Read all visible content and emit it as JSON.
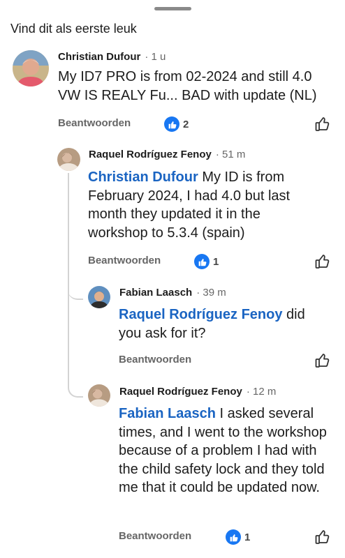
{
  "header": {
    "title": "Vind dit als eerste leuk"
  },
  "comments": [
    {
      "author": "Christian Dufour",
      "time": "· 1 u",
      "mention": "",
      "text": "My ID7 PRO is from 02-2024 and still 4.0 VW IS REALY Fu... BAD with update (NL)",
      "reply_label": "Beantwoorden",
      "reaction_count": "2",
      "avatar_icon": "avatar-christian"
    },
    {
      "author": "Raquel Rodríguez Fenoy",
      "time": "· 51 m",
      "mention": "Christian Dufour",
      "text": " My ID is from February 2024, I had 4.0 but last month they updated it in the workshop to 5.3.4 (spain)",
      "reply_label": "Beantwoorden",
      "reaction_count": "1",
      "avatar_icon": "avatar-raquel"
    },
    {
      "author": "Fabian Laasch",
      "time": "· 39 m",
      "mention": "Raquel Rodríguez Fenoy",
      "text": " did you ask for it?",
      "reply_label": "Beantwoorden",
      "reaction_count": "",
      "avatar_icon": "avatar-fabian"
    },
    {
      "author": "Raquel Rodríguez Fenoy",
      "time": "· 12 m",
      "mention": "Fabian Laasch",
      "text": " I asked several times, and I went to the workshop because of a problem I had with the child safety lock and they told  me that it could be updated now.",
      "reply_label": "Beantwoorden",
      "reaction_count": "1",
      "avatar_icon": "avatar-raquel"
    }
  ],
  "colors": {
    "mention": "#1a64c2",
    "like_badge": "#1877f2",
    "thread_line": "#d3d3d3"
  },
  "icons": {
    "reaction": "thumbs-up-icon",
    "like_button": "like-outline-icon"
  }
}
